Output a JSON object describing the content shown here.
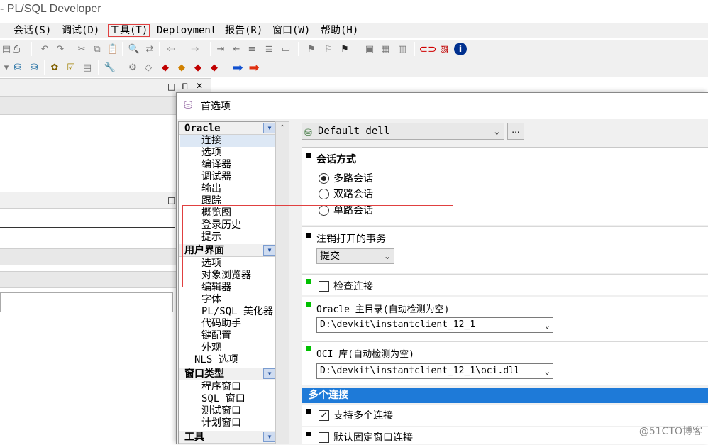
{
  "app": {
    "title": "- PL/SQL Developer"
  },
  "menu": [
    "会话(S)",
    "调试(D)",
    "工具(T)",
    "Deployment",
    "报告(R)",
    "窗口(W)",
    "帮助(H)"
  ],
  "dialog": {
    "title": "首选项",
    "tree": {
      "groups": [
        {
          "label": "Oracle",
          "items": [
            "连接",
            "选项",
            "编译器",
            "调试器",
            "输出",
            "跟踪",
            "概览图",
            "登录历史",
            "提示"
          ]
        },
        {
          "label": "用户界面",
          "items": [
            "选项",
            "对象浏览器",
            "编辑器",
            "字体",
            "PL/SQL 美化器",
            "代码助手",
            "键配置",
            "外观",
            "NLS 选项"
          ]
        },
        {
          "label": "窗口类型",
          "items": [
            "程序窗口",
            "SQL 窗口",
            "测试窗口",
            "计划窗口"
          ]
        },
        {
          "label": "工具",
          "items": []
        }
      ],
      "selected": "连接"
    },
    "connection_select": "Default dell",
    "ellipsis": "...",
    "session_mode": {
      "title": "会话方式",
      "options": [
        "多路会话",
        "双路会话",
        "单路会话"
      ],
      "selected": "多路会话"
    },
    "logoff_tx": {
      "title": "注销打开的事务",
      "value": "提交"
    },
    "check_connection": {
      "label": "检查连接",
      "checked": false
    },
    "oracle_home": {
      "title": "Oracle 主目录(自动检测为空)",
      "value": "D:\\devkit\\instantclient_12_1"
    },
    "oci_library": {
      "title": "OCI 库(自动检测为空)",
      "value": "D:\\devkit\\instantclient_12_1\\oci.dll"
    },
    "multi_conn": {
      "header": "多个连接",
      "support_label": "支持多个连接",
      "support_checked": true,
      "default_fixed_label": "默认固定窗口连接"
    }
  },
  "watermark": "@51CTO博客"
}
